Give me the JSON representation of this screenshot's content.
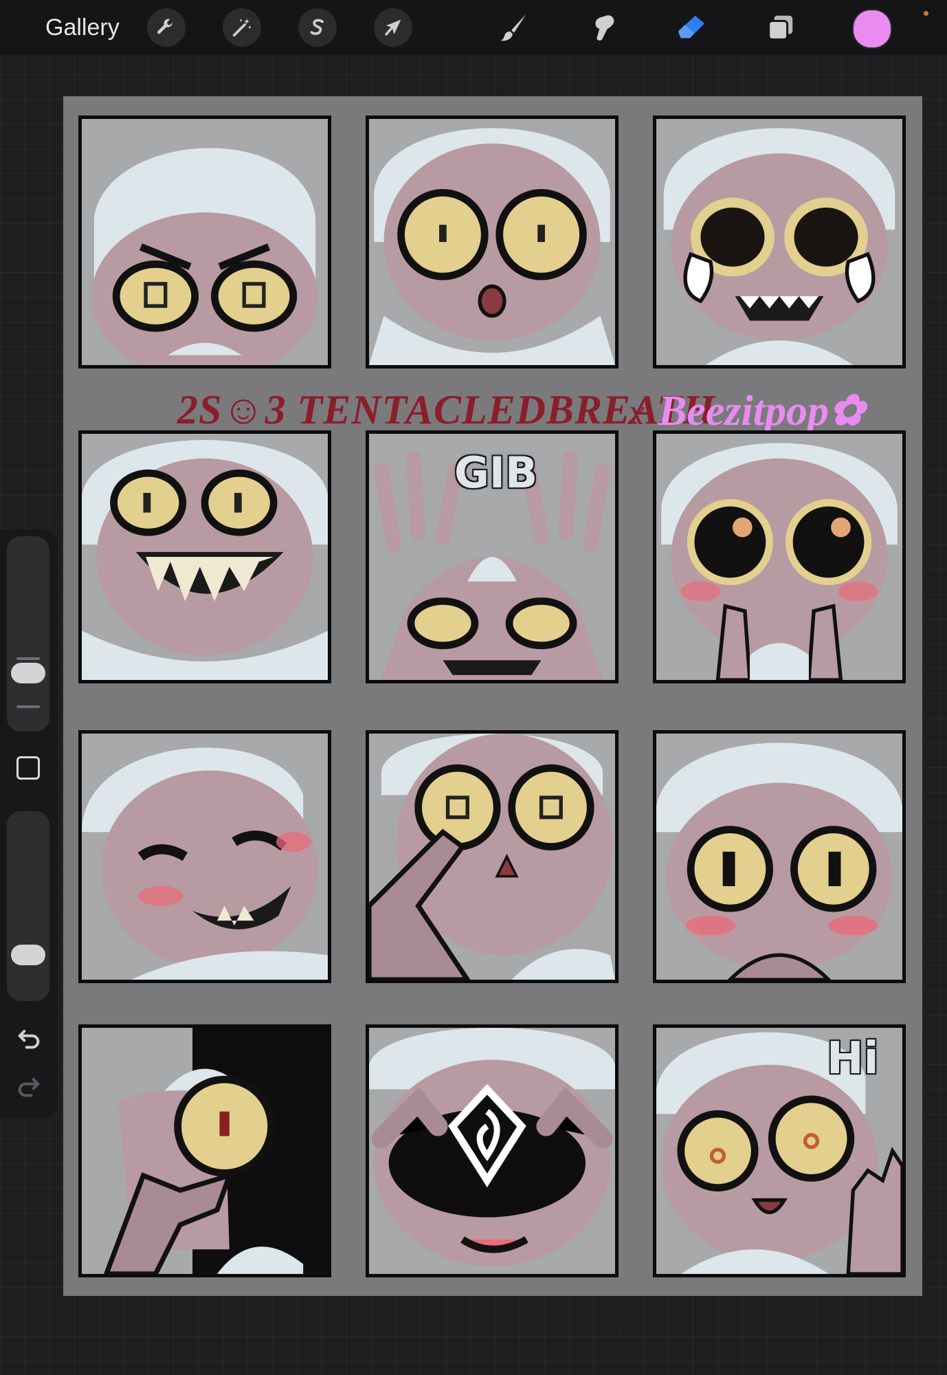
{
  "topbar": {
    "gallery_label": "Gallery",
    "left_tools": [
      {
        "icon": "wrench-icon",
        "name": "actions"
      },
      {
        "icon": "magic-wand-icon",
        "name": "adjustments"
      },
      {
        "icon": "selection-s-icon",
        "name": "selection"
      },
      {
        "icon": "arrow-cursor-icon",
        "name": "transform"
      }
    ],
    "right_tools": [
      {
        "icon": "brush-icon",
        "name": "paint",
        "active": false
      },
      {
        "icon": "smudge-icon",
        "name": "smudge",
        "active": false
      },
      {
        "icon": "eraser-icon",
        "name": "erase",
        "active": true
      },
      {
        "icon": "layers-icon",
        "name": "layers",
        "active": false
      }
    ],
    "current_color": "#e98bf0",
    "active_tool_color": "#2f7df2"
  },
  "canvas": {
    "credit_left": "2S☺3 TENTACLEDBREATH",
    "credit_x": "x",
    "credit_right": "Beezitpop✿",
    "credit_left_color": "#8a1e2b",
    "credit_right_color": "#e98bf0",
    "tile_texts": {
      "gib": "GIB",
      "hi": "Hi"
    }
  },
  "colors": {
    "skin": "#b89aa2",
    "hair": "#dde6ea",
    "eye": "#e3cf8e",
    "blush": "#e86b7a",
    "tile_bg": "#a7a9ab",
    "canvas_bg": "#7a7a7c"
  }
}
